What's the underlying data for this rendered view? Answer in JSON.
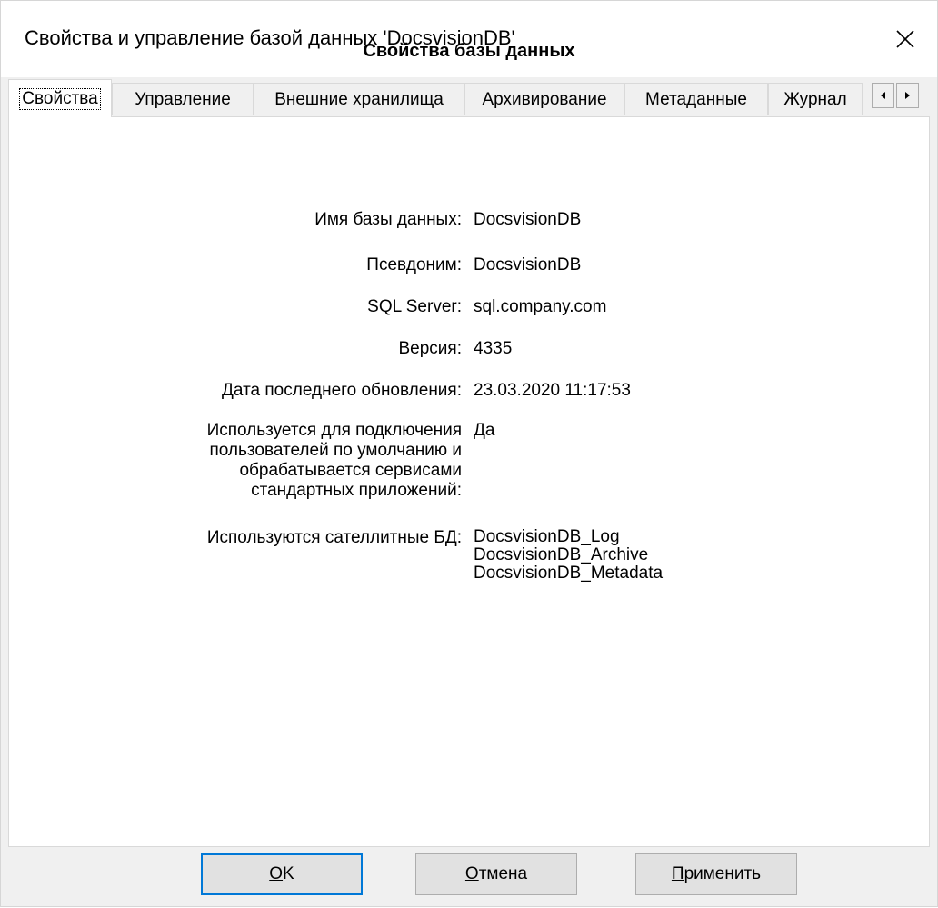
{
  "window": {
    "title": "Свойства и управление базой данных 'DocsvisionDB'",
    "close_icon": "close-icon"
  },
  "tabs": [
    {
      "label": "Свойства",
      "active": true
    },
    {
      "label": "Управление",
      "active": false
    },
    {
      "label": "Внешние хранилища",
      "active": false
    },
    {
      "label": "Архивирование",
      "active": false
    },
    {
      "label": "Метаданные",
      "active": false
    },
    {
      "label": "Журнал",
      "active": false
    }
  ],
  "tab_scroll": {
    "left_icon": "scroll-left-icon",
    "right_icon": "scroll-right-icon"
  },
  "panel": {
    "heading": "Свойства базы данных",
    "rows": [
      {
        "label": "Имя базы данных:",
        "value": "DocsvisionDB"
      },
      {
        "label": "Псевдоним:",
        "value": "DocsvisionDB"
      },
      {
        "label": "SQL Server:",
        "value": "sql.company.com"
      },
      {
        "label": "Версия:",
        "value": "4335"
      },
      {
        "label": "Дата последнего обновления:",
        "value": "23.03.2020 11:17:53"
      },
      {
        "label_lines": [
          "Используется для подключения",
          "пользователей по умолчанию и",
          "обрабатывается сервисами",
          "стандартных приложений:"
        ],
        "value": "Да"
      },
      {
        "label": "Используются сателлитные БД:",
        "values": [
          "DocsvisionDB_Log",
          "DocsvisionDB_Archive",
          "DocsvisionDB_Metadata"
        ]
      }
    ]
  },
  "buttons": {
    "ok": {
      "mnemonic": "O",
      "rest": "K"
    },
    "cancel": {
      "mnemonic": "О",
      "rest": "тмена"
    },
    "apply": {
      "mnemonic": "П",
      "rest": "рименить"
    }
  },
  "colors": {
    "default_button_border": "#0078d7",
    "dialog_bg": "#f0f0f0",
    "panel_bg": "#ffffff"
  }
}
